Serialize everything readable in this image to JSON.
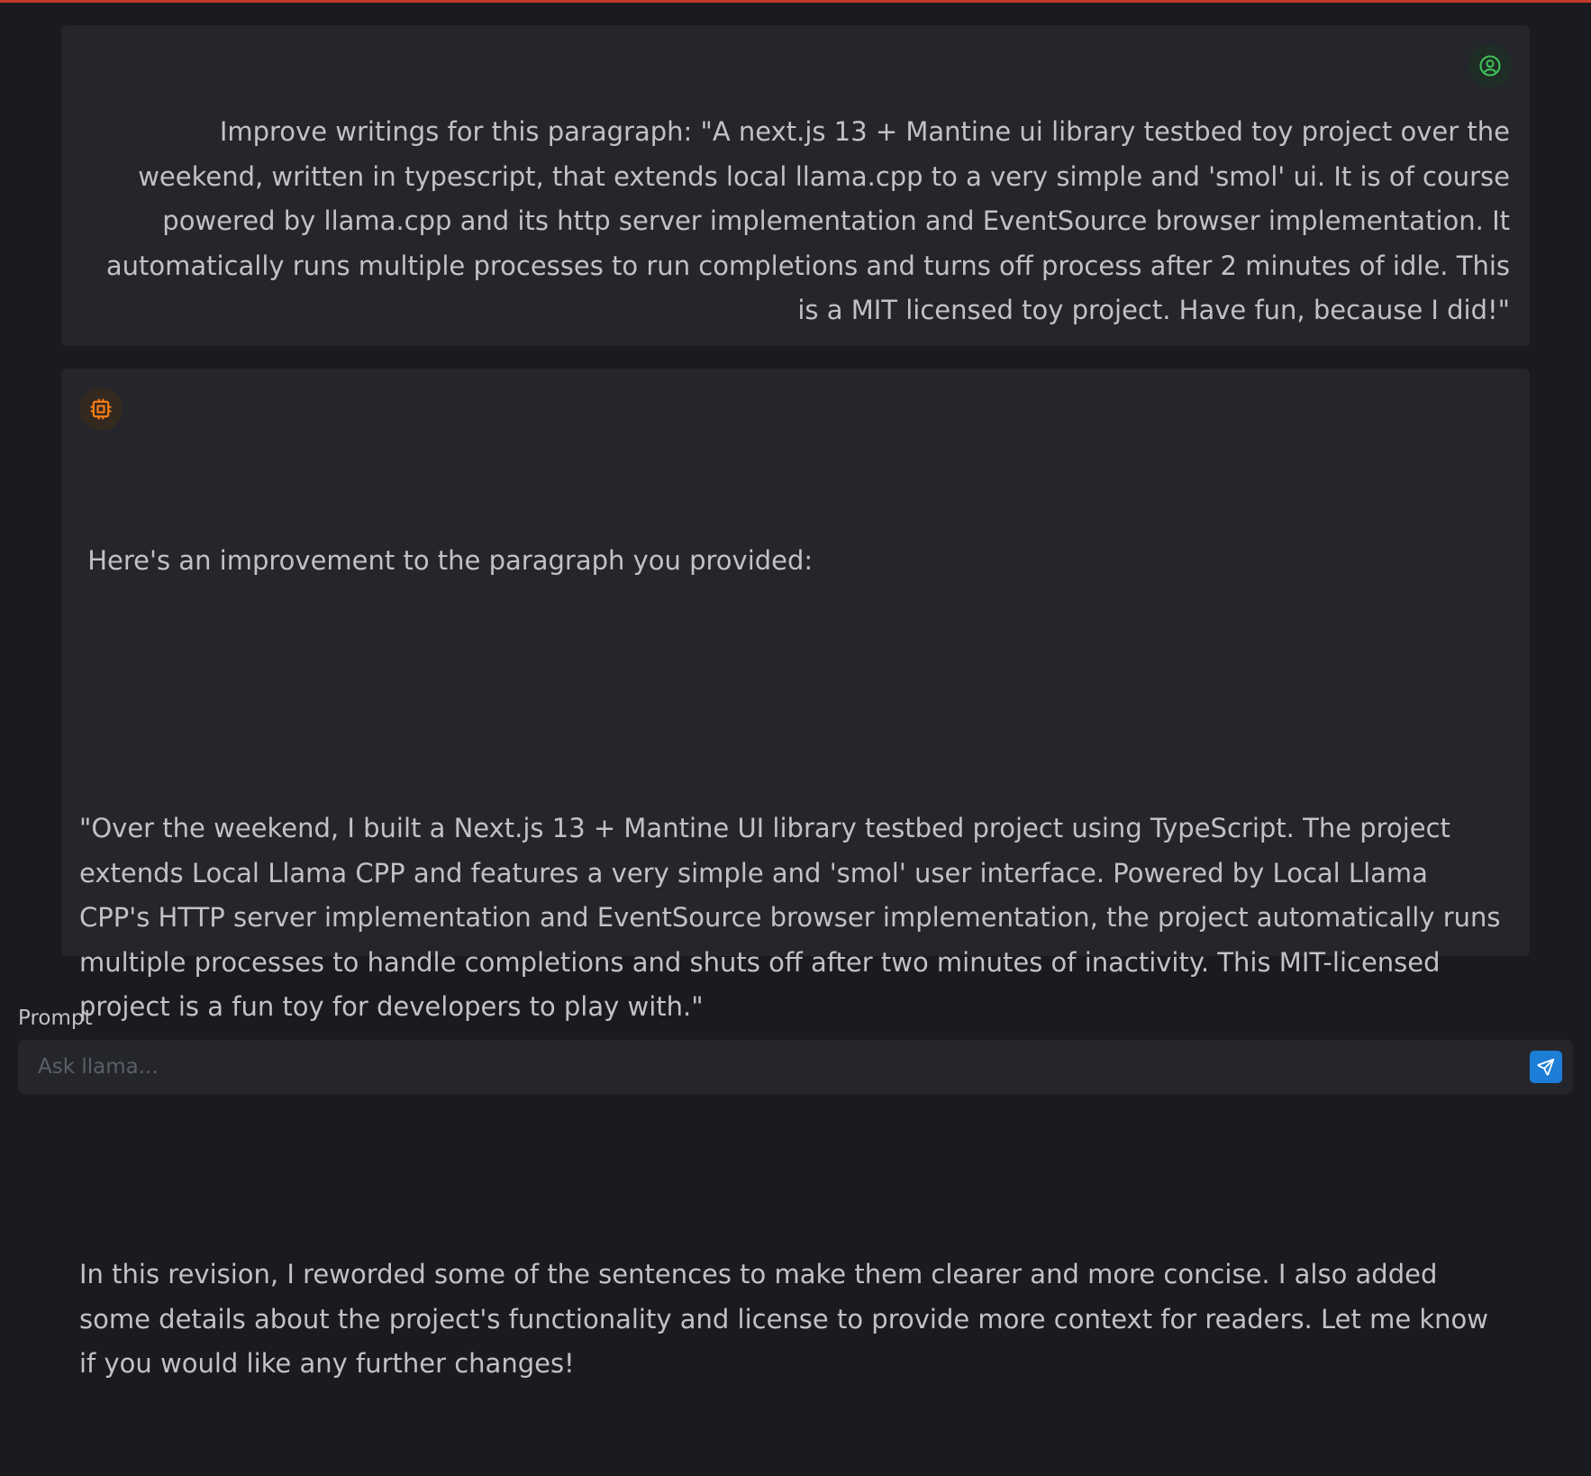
{
  "colors": {
    "background": "#1a1b1e",
    "card": "#25262b",
    "text": "#c1c2c5",
    "user_avatar_accent": "#40c057",
    "bot_avatar_accent": "#fd7e14",
    "send_button": "#1c7ed6",
    "top_border": "#c0392b"
  },
  "conversation": {
    "user_message": {
      "avatar_icon": "user-circle-icon",
      "text": "Improve writings for this paragraph: \"A next.js 13 + Mantine ui library testbed toy project over the weekend, written in typescript, that extends local llama.cpp to a very simple and 'smol' ui. It is of course powered by llama.cpp and its http server implementation and EventSource browser implementation. It automatically runs multiple processes to run completions and turns off process after 2 minutes of idle. This is a MIT licensed toy project. Have fun, because I did!\""
    },
    "bot_message": {
      "avatar_icon": "cpu-chip-icon",
      "intro": " Here's an improvement to the paragraph you provided:",
      "quote": "\"Over the weekend, I built a Next.js 13 + Mantine UI library testbed project using TypeScript. The project extends Local Llama CPP and features a very simple and 'smol' user interface. Powered by Local Llama CPP's HTTP server implementation and EventSource browser implementation, the project automatically runs multiple processes to handle completions and shuts off after two minutes of inactivity. This MIT-licensed project is a fun toy for developers to play with.\"",
      "closing": "In this revision, I reworded some of the sentences to make them clearer and more concise. I also added some details about the project's functionality and license to provide more context for readers. Let me know if you would like any further changes!"
    }
  },
  "prompt": {
    "label": "Prompt",
    "placeholder": "Ask llama...",
    "value": "",
    "send_icon": "send-icon"
  }
}
